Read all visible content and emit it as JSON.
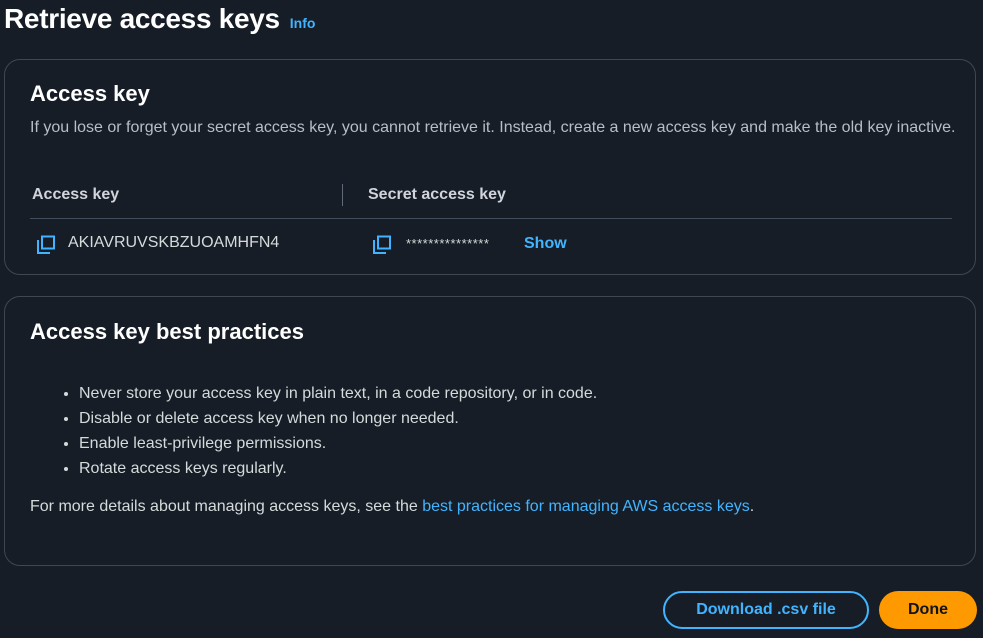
{
  "header": {
    "title": "Retrieve access keys",
    "info_label": "Info"
  },
  "access_key_card": {
    "title": "Access key",
    "description": "If you lose or forget your secret access key, you cannot retrieve it. Instead, create a new access key and make the old key inactive.",
    "columns": {
      "access_key_header": "Access key",
      "secret_key_header": "Secret access key"
    },
    "access_key_value": "AKIAVRUVSKBZUOAMHFN4",
    "secret_key_masked": "***************",
    "show_label": "Show",
    "icons": {
      "copy_access_key": "copy-icon",
      "copy_secret_key": "copy-icon"
    }
  },
  "best_practices_card": {
    "title": "Access key best practices",
    "items": [
      "Never store your access key in plain text, in a code repository, or in code.",
      "Disable or delete access key when no longer needed.",
      "Enable least-privilege permissions.",
      "Rotate access keys regularly."
    ],
    "details_prefix": "For more details about managing access keys, see the ",
    "details_link": "best practices for managing AWS access keys",
    "details_suffix": "."
  },
  "footer": {
    "download_label": "Download .csv file",
    "done_label": "Done"
  },
  "colors": {
    "background": "#161d26",
    "link": "#42b4ff",
    "primary_button": "#ff9900",
    "border": "#424650"
  }
}
